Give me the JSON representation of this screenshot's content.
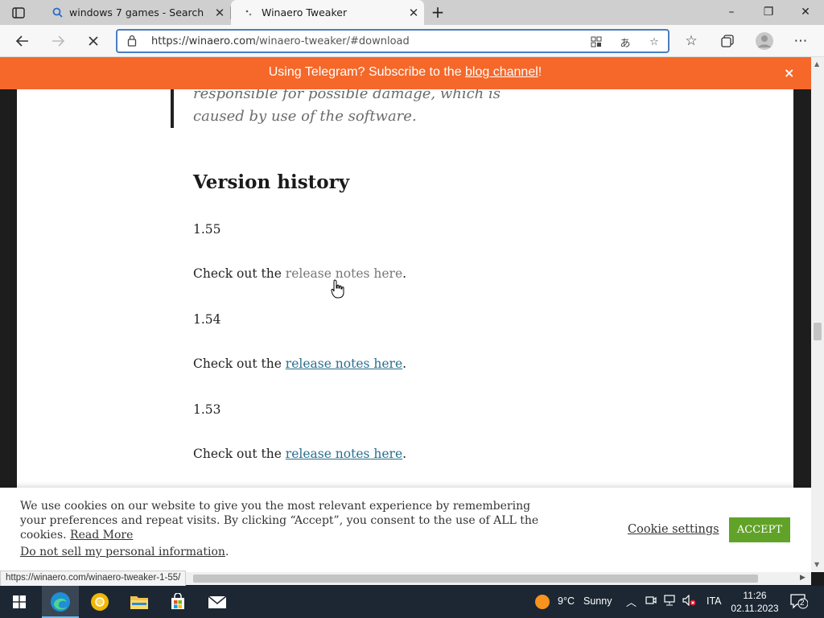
{
  "browser": {
    "tabs": [
      {
        "title": "windows 7 games - Search",
        "active": false,
        "favicon": "search-icon"
      },
      {
        "title": "Winaero Tweaker",
        "active": true,
        "favicon": "loading-icon"
      }
    ],
    "new_tab": "+",
    "address": {
      "url_host": "https://winaero.com",
      "url_path": "/winaero-tweaker/#download"
    },
    "window_controls": {
      "minimize": "–",
      "restore": "❐",
      "close": "✕"
    }
  },
  "banner": {
    "prefix": "Using Telegram? Subscribe to the ",
    "link": "blog channel",
    "suffix": "!",
    "close": "×",
    "color": "#f5682a"
  },
  "article": {
    "quote_text": "responsible for possible damage, which is caused by use of the software.",
    "heading": "Version history",
    "check_prefix": "Check out the ",
    "link_text": "release notes here",
    "period": ".",
    "versions": [
      {
        "version": "1.55"
      },
      {
        "version": "1.54"
      },
      {
        "version": "1.53"
      }
    ],
    "link_color": "#2a6f8f"
  },
  "status_url": "https://winaero.com/winaero-tweaker-1-55/",
  "cookie": {
    "text": "We use cookies on our website to give you the most relevant experience by remembering your preferences and repeat visits. By clicking “Accept”, you consent to the use of ALL the cookies.",
    "read_more": "Read More",
    "do_not_sell": "Do not sell my personal information",
    "do_not_sell_period": ".",
    "settings": "Cookie settings",
    "accept": "ACCEPT",
    "accept_color": "#61a229"
  },
  "taskbar": {
    "weather_temp": "9°C",
    "weather_text": "Sunny",
    "language": "ITA",
    "time": "11:26",
    "date": "02.11.2023",
    "notifications": "2"
  }
}
